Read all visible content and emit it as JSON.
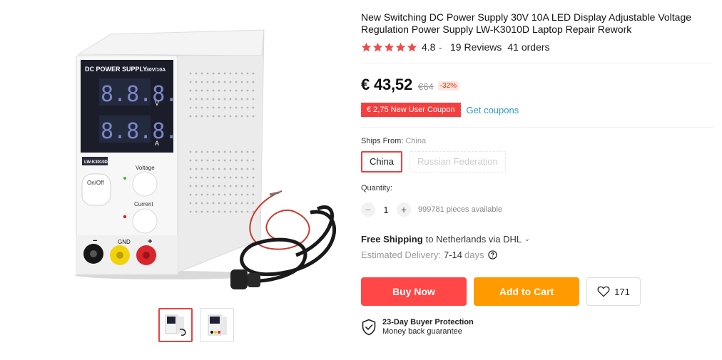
{
  "product": {
    "title": "New Switching DC Power Supply 30V 10A LED Display Adjustable Voltage Regulation Power Supply LW-K3010D Laptop Repair Rework",
    "rating_value": "4.8",
    "rating_stars": 5,
    "reviews": "19 Reviews",
    "orders": "41 orders"
  },
  "device": {
    "panel_label": "DC POWER SUPPLY",
    "panel_spec": "30V/10A",
    "display_top": "8.8.8.",
    "display_bottom": "8.8.8.",
    "unit_v": "V",
    "unit_a": "A",
    "model_tag": "LW-K3010D",
    "knob_voltage": "Voltage",
    "knob_current": "Current",
    "power_button": "On/Off",
    "terminal_minus": "−",
    "terminal_gnd": "GND",
    "terminal_plus": "+"
  },
  "price": {
    "current": "€ 43,52",
    "original": "€64",
    "discount": "-32%"
  },
  "coupon": {
    "label": "€ 2,75 New User Coupon",
    "link": "Get coupons"
  },
  "ships_from": {
    "label": "Ships From:",
    "value": "China",
    "options": [
      "China",
      "Russian Federation"
    ]
  },
  "quantity": {
    "label": "Quantity:",
    "minus": "−",
    "value": "1",
    "plus": "+",
    "available": "999781 pieces available"
  },
  "shipping": {
    "free": "Free Shipping",
    "destination": "to Netherlands via DHL",
    "delivery_label": "Estimated Delivery:",
    "delivery_days": "7-14",
    "delivery_unit": "days"
  },
  "actions": {
    "buy_now": "Buy Now",
    "add_to_cart": "Add to Cart",
    "wishlist_count": "171"
  },
  "protection": {
    "title": "23-Day Buyer Protection",
    "subtitle": "Money back guarantee"
  },
  "colors": {
    "accent_red": "#ff4747",
    "cart_orange": "#ff9a00",
    "star": "#f24a4a",
    "link": "#2e9cc3"
  }
}
